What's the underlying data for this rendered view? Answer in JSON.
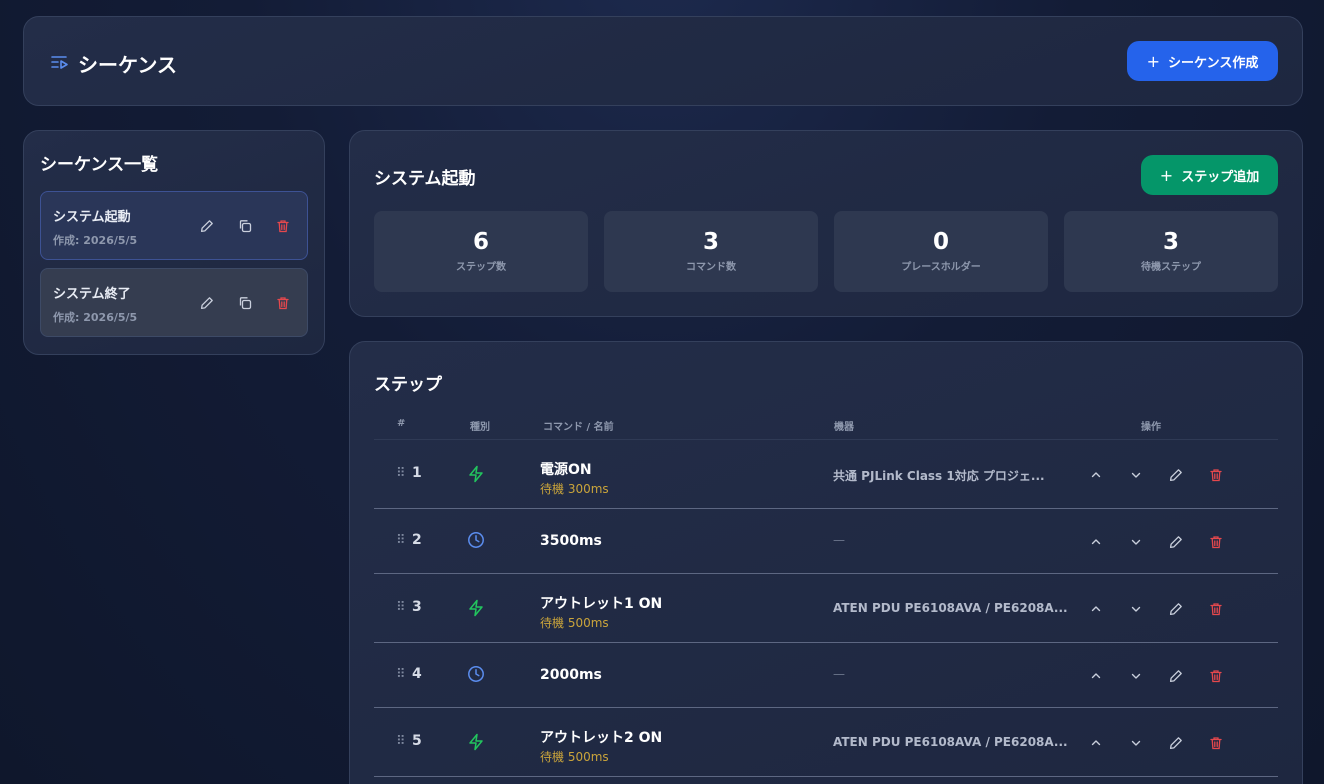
{
  "header": {
    "title": "シーケンス",
    "create_button": "シーケンス作成"
  },
  "sidebar": {
    "title": "シーケンス一覧",
    "items": [
      {
        "name": "システム起動",
        "date": "作成: 2026/5/5"
      },
      {
        "name": "システム終了",
        "date": "作成: 2026/5/5"
      }
    ]
  },
  "summary": {
    "title": "システム起動",
    "add_step_button": "ステップ追加",
    "stats": [
      {
        "value": "6",
        "label": "ステップ数"
      },
      {
        "value": "3",
        "label": "コマンド数"
      },
      {
        "value": "0",
        "label": "プレースホルダー"
      },
      {
        "value": "3",
        "label": "待機ステップ"
      }
    ]
  },
  "steps": {
    "title": "ステップ",
    "columns": {
      "num": "#",
      "kind": "種別",
      "command": "コマンド / 名前",
      "device": "機器",
      "ops": "操作"
    },
    "rows": [
      {
        "index": "1",
        "kind": "command",
        "name": "電源ON",
        "wait": "待機 300ms",
        "device": "共通 PJLink Class 1対応 プロジェ..."
      },
      {
        "index": "2",
        "kind": "wait",
        "name": "3500ms",
        "wait": "",
        "device": "—"
      },
      {
        "index": "3",
        "kind": "command",
        "name": "アウトレット1 ON",
        "wait": "待機 500ms",
        "device": "ATEN PDU PE6108AVA / PE6208A..."
      },
      {
        "index": "4",
        "kind": "wait",
        "name": "2000ms",
        "wait": "",
        "device": "—"
      },
      {
        "index": "5",
        "kind": "command",
        "name": "アウトレット2 ON",
        "wait": "待機 500ms",
        "device": "ATEN PDU PE6108AVA / PE6208A..."
      }
    ]
  },
  "colors": {
    "accent_blue": "#2563eb",
    "accent_green": "#059669",
    "delete_red": "#e5484d",
    "wait_text": "#caa43b"
  }
}
